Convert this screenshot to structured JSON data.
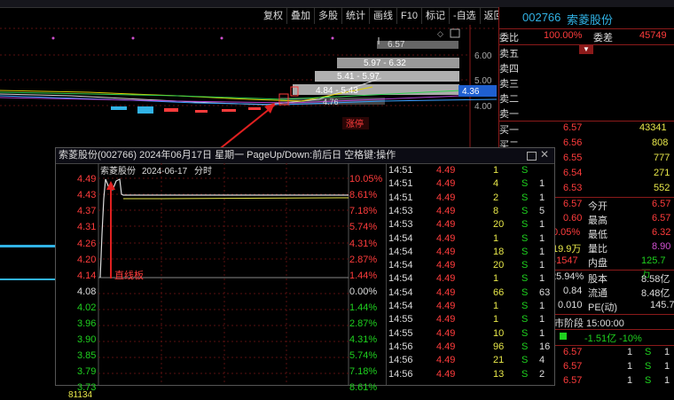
{
  "toolbar": {
    "items": [
      "复权",
      "叠加",
      "多股",
      "统计",
      "画线",
      "F10",
      "标记",
      "-自选",
      "返回"
    ]
  },
  "main": {
    "price_levels": [
      "6.00",
      "5.00",
      "4.00"
    ],
    "bands": [
      "6.57",
      "5.97 - 6.32",
      "5.41 - 5.97",
      "4.84 - 5.43",
      "4.36",
      "4.76"
    ],
    "last_price_label": "4.36",
    "limit_tag": "涨停"
  },
  "quote": {
    "code": "002766",
    "name": "索菱股份",
    "weibi_label": "委比",
    "weibi_value": "100.00%",
    "weicha_label": "委差",
    "weicha_value": "45749",
    "sell_labels": [
      "卖五",
      "卖四",
      "卖三",
      "卖二",
      "卖一"
    ],
    "buy": [
      {
        "label": "买一",
        "price": "6.57",
        "vol": "43341"
      },
      {
        "label": "买二",
        "price": "6.56",
        "vol": "808"
      },
      {
        "label": "",
        "price": "6.55",
        "vol": "777"
      },
      {
        "label": "",
        "price": "6.54",
        "vol": "271"
      },
      {
        "label": "",
        "price": "6.53",
        "vol": "552"
      }
    ],
    "stats": [
      {
        "l": "6.57",
        "k": "今开",
        "v": "6.57"
      },
      {
        "l": "0.60",
        "k": "最高",
        "v": "6.57"
      },
      {
        "l": "0.05%",
        "k": "最低",
        "v": "6.32"
      },
      {
        "l": "19.9万",
        "k": "量比",
        "v": "8.90"
      },
      {
        "l": "41547",
        "k": "内盘",
        "v": "125.7万"
      },
      {
        "l": "25.94%",
        "k": "股本",
        "v": "8.58亿"
      },
      {
        "l": "0.84",
        "k": "流通",
        "v": "8.48亿"
      },
      {
        "l": "0.010",
        "k": "PE(动)",
        "v": "145.7"
      }
    ],
    "session": "市阶段 15:00:00",
    "flow": "-1.51亿 -10%",
    "trades": [
      {
        "p": "6.57",
        "v": "1",
        "t": "S",
        "n": "1"
      },
      {
        "p": "6.57",
        "v": "1",
        "t": "S",
        "n": "1"
      },
      {
        "p": "6.57",
        "v": "1",
        "t": "S",
        "n": "1"
      }
    ]
  },
  "popup": {
    "title": "索菱股份(002766)  2024年06月17日 星期一  PageUp/Down:前后日 空格键:操作",
    "sub_name": "索菱股份",
    "sub_date": "2024-06-17",
    "sub_type": "分时",
    "annotation": "直线板",
    "yleft": [
      "4.49",
      "4.43",
      "4.37",
      "4.31",
      "4.26",
      "4.20",
      "4.14",
      "4.08",
      "4.02",
      "3.96",
      "3.90",
      "3.85",
      "3.79",
      "3.73",
      "81134"
    ],
    "yright": [
      "10.05%",
      "8.61%",
      "7.18%",
      "5.74%",
      "4.31%",
      "2.87%",
      "1.44%",
      "0.00%",
      "1.44%",
      "2.87%",
      "4.31%",
      "5.74%",
      "7.18%",
      "8.61%"
    ],
    "ticks": [
      {
        "t": "14:51",
        "p": "4.49",
        "v": "1",
        "s": "S",
        "x": ""
      },
      {
        "t": "14:51",
        "p": "4.49",
        "v": "4",
        "s": "S",
        "x": "1"
      },
      {
        "t": "14:51",
        "p": "4.49",
        "v": "2",
        "s": "S",
        "x": "1"
      },
      {
        "t": "14:53",
        "p": "4.49",
        "v": "8",
        "s": "S",
        "x": "5"
      },
      {
        "t": "14:53",
        "p": "4.49",
        "v": "20",
        "s": "S",
        "x": "1"
      },
      {
        "t": "14:54",
        "p": "4.49",
        "v": "1",
        "s": "S",
        "x": "1"
      },
      {
        "t": "14:54",
        "p": "4.49",
        "v": "18",
        "s": "S",
        "x": "1"
      },
      {
        "t": "14:54",
        "p": "4.49",
        "v": "20",
        "s": "S",
        "x": "1"
      },
      {
        "t": "14:54",
        "p": "4.49",
        "v": "1",
        "s": "S",
        "x": "1"
      },
      {
        "t": "14:54",
        "p": "4.49",
        "v": "66",
        "s": "S",
        "x": "63"
      },
      {
        "t": "14:54",
        "p": "4.49",
        "v": "1",
        "s": "S",
        "x": "1"
      },
      {
        "t": "14:55",
        "p": "4.49",
        "v": "1",
        "s": "S",
        "x": "1"
      },
      {
        "t": "14:55",
        "p": "4.49",
        "v": "10",
        "s": "S",
        "x": "1"
      },
      {
        "t": "14:56",
        "p": "4.49",
        "v": "96",
        "s": "S",
        "x": "16"
      },
      {
        "t": "14:56",
        "p": "4.49",
        "v": "21",
        "s": "S",
        "x": "4"
      },
      {
        "t": "14:56",
        "p": "4.49",
        "v": "13",
        "s": "S",
        "x": "2"
      }
    ]
  }
}
